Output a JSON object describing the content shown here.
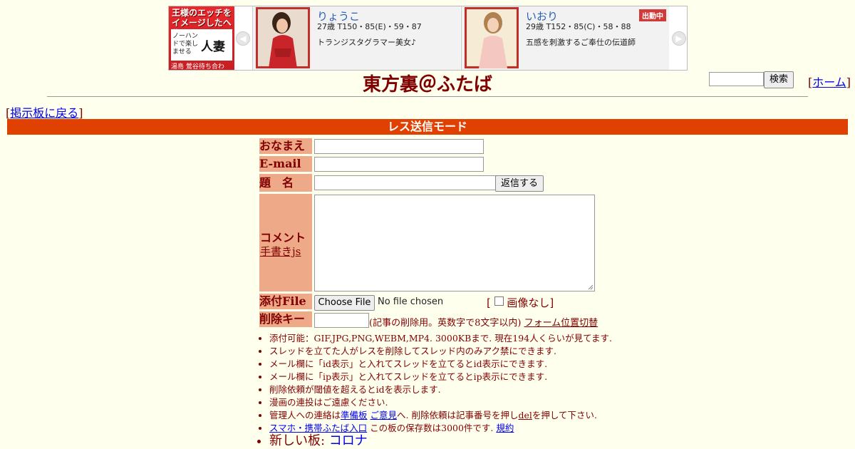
{
  "ad": {
    "left_line1": "王様のエッチを",
    "left_line2": "イメージしたヘルス",
    "left_small": "ノーハンドで楽しませる",
    "left_big": "人妻",
    "left_footer": "湯島 鶯谷待ち合わせ・出張",
    "profiles": [
      {
        "name": "りょうこ",
        "spec": "27歳 T150・85(E)・59・87",
        "desc": "トランジスタグラマー美女♪",
        "badge": ""
      },
      {
        "name": "いおり",
        "spec": "29歳 T152・85(C)・58・88",
        "desc": "五感を刺激するご奉仕の伝道師",
        "badge": "出勤中"
      }
    ]
  },
  "header": {
    "title": "東方裏＠ふたば",
    "search_button": "検索",
    "home_link": "ホーム",
    "back_link": "掲示板に戻る"
  },
  "mode_bar": "レス送信モード",
  "form": {
    "name_label": "おなまえ",
    "email_label": "E-mail",
    "subject_label": "題　名",
    "reply_button": "返信する",
    "comment_label": "コメント",
    "handwriting_link": "手書きjs",
    "file_label": "添付File",
    "choose_file_button": "Choose File",
    "no_file_text": "No file chosen",
    "no_image_label": "画像なし",
    "delete_key_label": "削除キー",
    "delete_key_note": "(記事の削除用。英数字で8文字以内)",
    "form_position_link": "フォーム位置切替"
  },
  "notes": {
    "n1": "添付可能：GIF,JPG,PNG,WEBM,MP4. 3000KBまで. 現在194人くらいが見てます.",
    "n2": "スレッドを立てた人がレスを削除してスレッド内のみアク禁にできます.",
    "n3": "メール欄に「id表示」と入れてスレッドを立てるとid表示にできます.",
    "n4": "メール欄に「ip表示」と入れてスレッドを立てるとip表示にできます.",
    "n5": "削除依頼が閾値を超えるとidを表示します.",
    "n6": "漫画の連投はご遠慮ください.",
    "n7_pre": "管理人への連絡は",
    "n7_link1": "準備板",
    "n7_link2": "ご意見",
    "n7_mid": "へ. 削除依頼は記事番号を押し",
    "n7_link3": "del",
    "n7_post": "を押して下さい.",
    "n8_link": "スマホ・携帯ふたば入口",
    "n8_text": " この板の保存数は3000件です.",
    "n8_link2": "規約",
    "n9_pre": "新しい板: ",
    "n9_link": "コロナ"
  },
  "colors": {
    "background": "#ffffee",
    "text": "#800000",
    "mode_bar": "#e04000",
    "label_bg": "#eeaa88"
  }
}
